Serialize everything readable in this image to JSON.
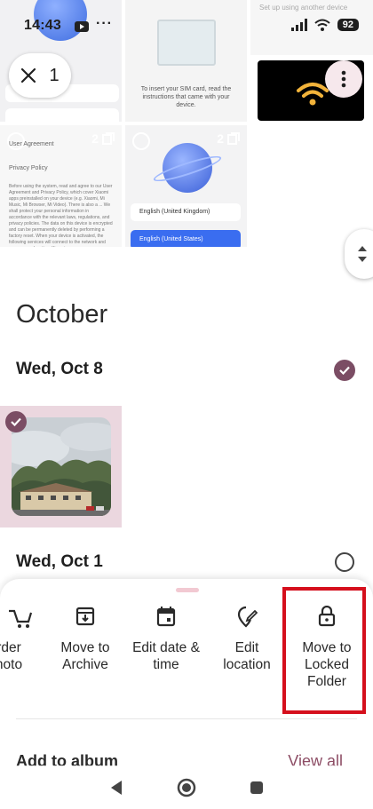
{
  "status_bar": {
    "time": "14:43",
    "battery": "92",
    "icons": [
      "youtube-icon",
      "more-dots-icon",
      "signal-icon",
      "wifi-icon",
      "battery-icon"
    ]
  },
  "selection": {
    "count": "1",
    "close_icon": "close-icon"
  },
  "grid_top": {
    "tile_setup_text": "Set up using another device",
    "tile_sim_text": "To insert your SIM card, read the instructions that came with your device.",
    "tile_doc_count": "2",
    "tile_lang_count": "2",
    "doc": {
      "title": "User Agreement",
      "subtitle": "Privacy Policy",
      "body": "Before using the system, read and agree to our User Agreement and Privacy Policy, which cover Xiaomi apps preinstalled on your device (e.g. Xiaomi, Mi Music, Mi Browser, Mi Video). There is also a ... We shall protect your personal information in accordance with the relevant laws, regulations, and privacy policies. The data on this device is encrypted and can be permanently deleted by performing a factory reset. When your device is activated, the following services will connect to the network and access your location: Xiaomi"
    },
    "lang": {
      "option_1": "English (United Kingdom)",
      "option_2": "English (United States)"
    }
  },
  "timeline": {
    "month": "October",
    "days": [
      {
        "label": "Wed, Oct 8",
        "selected": true
      },
      {
        "label": "Wed, Oct 1",
        "selected": false
      }
    ]
  },
  "sheet": {
    "actions": [
      {
        "label_1": "rder",
        "label_2": "hoto",
        "icon": "cart-icon"
      },
      {
        "label_1": "Move to",
        "label_2": "Archive",
        "icon": "archive-icon"
      },
      {
        "label_1": "Edit date &",
        "label_2": "time",
        "icon": "calendar-icon"
      },
      {
        "label_1": "Edit",
        "label_2": "location",
        "icon": "location-edit-icon"
      },
      {
        "label_1": "Move to",
        "label_2": "Locked",
        "label_3": "Folder",
        "icon": "lock-icon"
      }
    ],
    "add_to_album": "Add to album",
    "view_all": "View all"
  },
  "colors": {
    "accent": "#7b4d64",
    "highlight_box": "#d50f1c",
    "link": "#8d4d65",
    "selected_bg": "#ebd7df"
  }
}
